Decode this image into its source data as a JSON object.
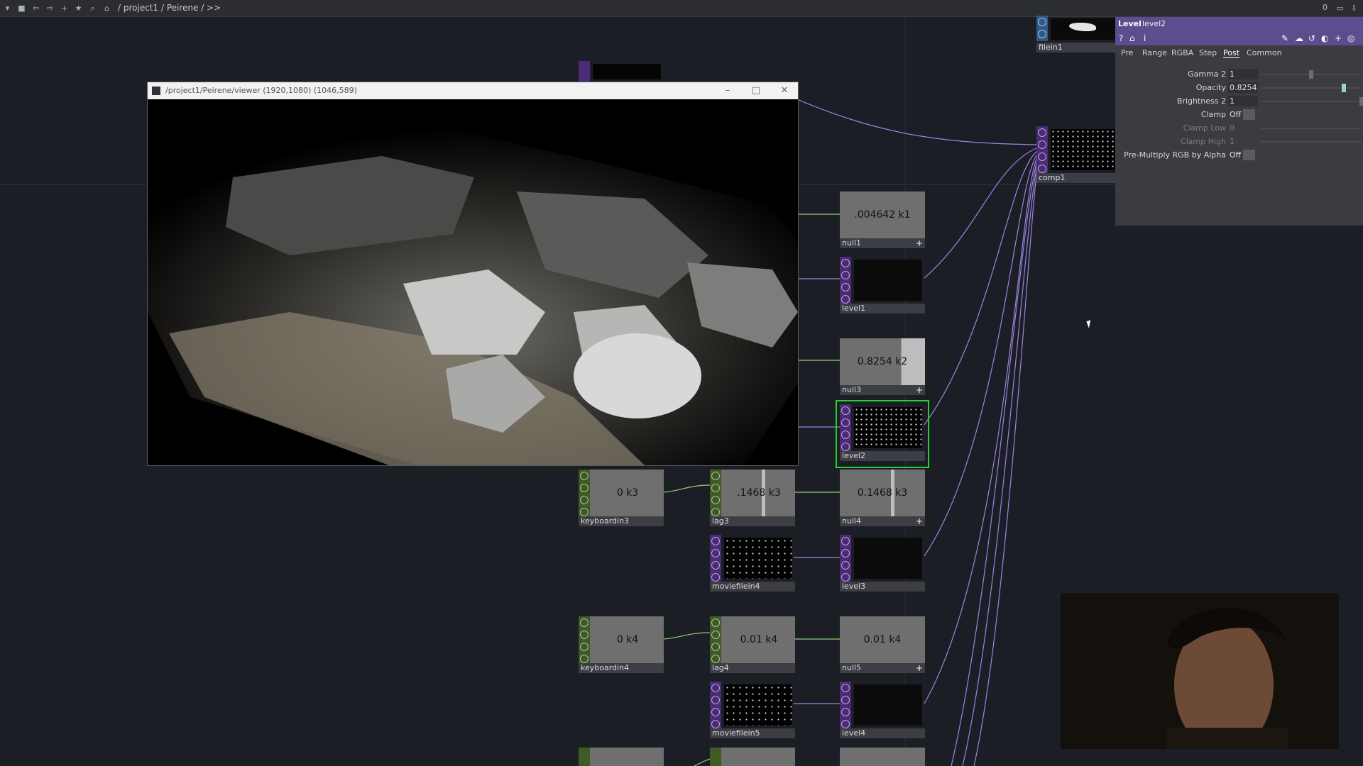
{
  "topbar": {
    "path": "/ project1 / Peirene / >>",
    "right_value": "0"
  },
  "viewer": {
    "title": "/project1/Peirene/viewer (1920,1080) (1046,589)",
    "minimize": "–",
    "maximize": "□",
    "close": "✕"
  },
  "nodes": {
    "filein1": {
      "name": "filein1"
    },
    "comp1": {
      "name": "comp1"
    },
    "null1": {
      "name": "null1",
      "value": ".004642 k1"
    },
    "level1": {
      "name": "level1"
    },
    "null3": {
      "name": "null3",
      "value": "0.8254 k2"
    },
    "level2": {
      "name": "level2"
    },
    "keyboardin3": {
      "name": "keyboardin3",
      "value": "0 k3"
    },
    "lag3": {
      "name": "lag3",
      "value": ".1468 k3"
    },
    "null4": {
      "name": "null4",
      "value": "0.1468 k3"
    },
    "moviefilein4": {
      "name": "moviefilein4"
    },
    "level3": {
      "name": "level3"
    },
    "keyboardin4": {
      "name": "keyboardin4",
      "value": "0 k4"
    },
    "lag4": {
      "name": "lag4",
      "value": "0.01 k4"
    },
    "null5": {
      "name": "null5",
      "value": "0.01 k4"
    },
    "moviefilein5": {
      "name": "moviefilein5"
    },
    "level4": {
      "name": "level4"
    }
  },
  "param": {
    "kind": "Level",
    "name": "level2",
    "tabs": [
      "Pre",
      "Range",
      "RGBA",
      "Step",
      "Post",
      "Common"
    ],
    "active_tab": "Post",
    "params": {
      "gamma2": {
        "label": "Gamma 2",
        "value": "1",
        "slider": 0.5
      },
      "opacity": {
        "label": "Opacity",
        "value": "0.8254",
        "slider": 0.8254
      },
      "brightness2": {
        "label": "Brightness 2",
        "value": "1",
        "slider": 1.0
      },
      "clamp": {
        "label": "Clamp",
        "value": "Off"
      },
      "clamp_low": {
        "label": "Clamp Low",
        "value": "0"
      },
      "clamp_high": {
        "label": "Clamp High",
        "value": "1"
      },
      "premultiply": {
        "label": "Pre-Multiply RGB by Alpha",
        "value": "Off"
      }
    }
  },
  "colors": {
    "background": "#1c1e26",
    "top_strip": "#4b2a78",
    "chop_strip": "#3f5b24",
    "wire": "#9a86e0",
    "selected": "#23d22f"
  }
}
